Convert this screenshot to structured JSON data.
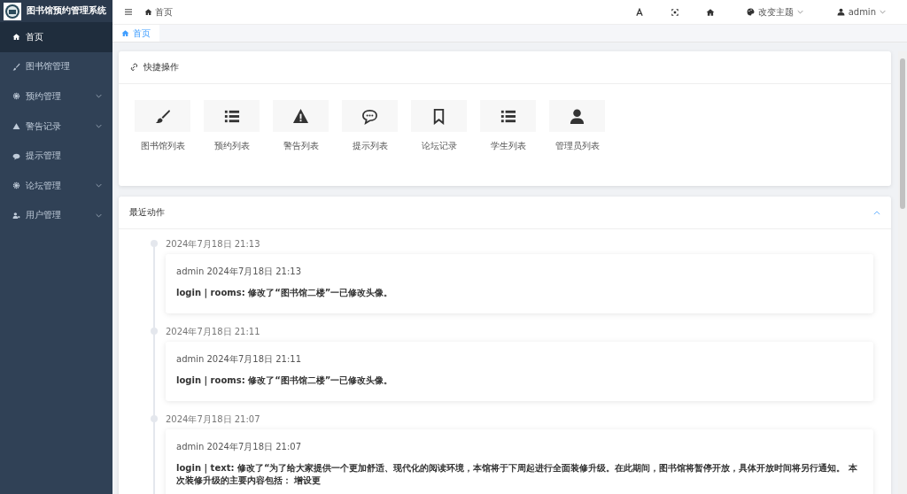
{
  "app": {
    "title": "图书馆预约管理系统"
  },
  "sidebar": {
    "items": [
      {
        "label": "首页",
        "kind": "home",
        "selected": true,
        "expandable": false
      },
      {
        "label": "图书馆管理",
        "kind": "brush",
        "selected": false,
        "expandable": false
      },
      {
        "label": "预约管理",
        "kind": "gear",
        "selected": false,
        "expandable": true
      },
      {
        "label": "警告记录",
        "kind": "warning",
        "selected": false,
        "expandable": true
      },
      {
        "label": "提示管理",
        "kind": "chat",
        "selected": false,
        "expandable": false
      },
      {
        "label": "论坛管理",
        "kind": "gear",
        "selected": false,
        "expandable": true
      },
      {
        "label": "用户管理",
        "kind": "user",
        "selected": false,
        "expandable": true
      }
    ]
  },
  "breadcrumb": "首页",
  "header": {
    "theme": "改变主题",
    "user": "admin"
  },
  "tabs": [
    {
      "label": "首页",
      "selected": true
    }
  ],
  "shortcuts": {
    "title": "快捷操作",
    "items": [
      {
        "label": "图书馆列表",
        "kind": "brush"
      },
      {
        "label": "预约列表",
        "kind": "list"
      },
      {
        "label": "警告列表",
        "kind": "warning"
      },
      {
        "label": "提示列表",
        "kind": "chat"
      },
      {
        "label": "论坛记录",
        "kind": "bookmark"
      },
      {
        "label": "学生列表",
        "kind": "list"
      },
      {
        "label": "管理员列表",
        "kind": "user"
      }
    ]
  },
  "recent": {
    "title": "最近动作",
    "expanded": true,
    "entries": [
      {
        "time": "2024年7月18日 21:13",
        "meta": "admin 2024年7月18日 21:13",
        "text": "login | rooms: 修改了“图书馆二楼”一已修改头像。"
      },
      {
        "time": "2024年7月18日 21:11",
        "meta": "admin 2024年7月18日 21:11",
        "text": "login | rooms: 修改了“图书馆二楼”一已修改头像。"
      },
      {
        "time": "2024年7月18日 21:07",
        "meta": "admin 2024年7月18日 21:07",
        "text": "login | text: 修改了“为了给大家提供一个更加舒适、现代化的阅读环境，本馆将于下周起进行全面装修升级。在此期间，图书馆将暂停开放，具体开放时间将另行通知。 本次装修升级的主要内容包括： 增设更"
      }
    ]
  }
}
